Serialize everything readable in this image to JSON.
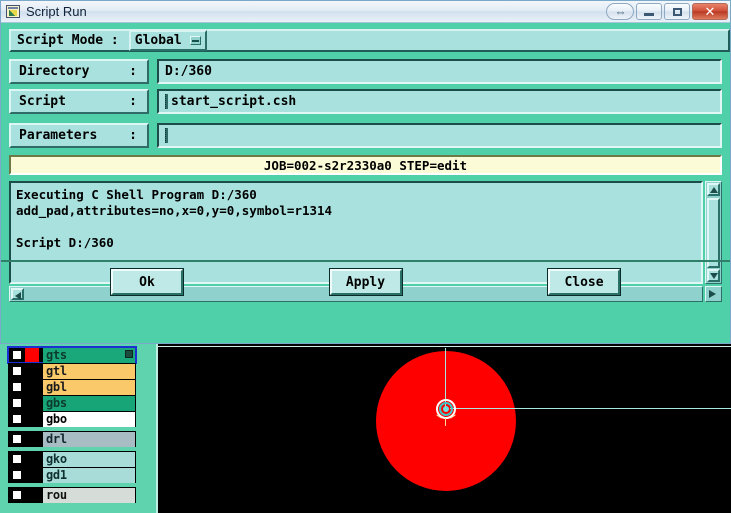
{
  "window": {
    "title": "Script Run",
    "icon": "script-app-icon",
    "controls": {
      "help_label": "⇔",
      "minimize_label": "",
      "maximize_label": "",
      "close_label": "✕"
    }
  },
  "script_mode": {
    "label": "Script Mode  :",
    "value": "Global",
    "dropdown_icon": "chevron-down-icon"
  },
  "fields": [
    {
      "label": "Directory",
      "colon": ":",
      "value": "D:/360",
      "placeholder": "",
      "has_caret": false
    },
    {
      "label": "Script",
      "colon": ":",
      "value": "start_script.csh",
      "placeholder": "",
      "has_caret": true
    },
    {
      "label": "Parameters",
      "colon": ":",
      "value": "",
      "placeholder": "",
      "has_caret": true
    }
  ],
  "status": {
    "text": "JOB=002-s2r2330a0    STEP=edit"
  },
  "console": {
    "lines": [
      "Executing C Shell Program D:/360",
      "add_pad,attributes=no,x=0,y=0,symbol=r1314",
      "",
      "Script D:/360"
    ]
  },
  "buttons": {
    "ok": "Ok",
    "apply": "Apply",
    "close": "Close"
  },
  "layers": {
    "rows": [
      {
        "name": "gts",
        "swatch": "#ff0000",
        "row_color": "#1aa87a",
        "text_color": "#0c3a2c",
        "checked": false,
        "selected": true,
        "badge": true,
        "gap_after": false
      },
      {
        "name": "gtl",
        "swatch": "#000000",
        "row_color": "#fac96a",
        "text_color": "#1b1b1b",
        "checked": false,
        "selected": false,
        "badge": false,
        "gap_after": false
      },
      {
        "name": "gbl",
        "swatch": "#000000",
        "row_color": "#fac96a",
        "text_color": "#1b1b1b",
        "checked": false,
        "selected": false,
        "badge": false,
        "gap_after": false
      },
      {
        "name": "gbs",
        "swatch": "#000000",
        "row_color": "#17a578",
        "text_color": "#0c3a2c",
        "checked": false,
        "selected": false,
        "badge": false,
        "gap_after": false
      },
      {
        "name": "gbo",
        "swatch": "#000000",
        "row_color": "#ffffff",
        "text_color": "#000000",
        "checked": false,
        "selected": false,
        "badge": false,
        "gap_after": true
      },
      {
        "name": "drl",
        "swatch": "#000000",
        "row_color": "#a8bcc4",
        "text_color": "#12262c",
        "checked": false,
        "selected": false,
        "badge": false,
        "gap_after": true
      },
      {
        "name": "gko",
        "swatch": "#000000",
        "row_color": "#a7dcd9",
        "text_color": "#10302e",
        "checked": false,
        "selected": false,
        "badge": false,
        "gap_after": false
      },
      {
        "name": "gd1",
        "swatch": "#000000",
        "row_color": "#a7dcd9",
        "text_color": "#10302e",
        "checked": false,
        "selected": false,
        "badge": false,
        "gap_after": true
      },
      {
        "name": "rou",
        "swatch": "#000000",
        "row_color": "#d6dcd8",
        "text_color": "#121212",
        "checked": false,
        "selected": false,
        "badge": false,
        "gap_after": true
      }
    ]
  },
  "canvas": {
    "pad_color": "#ff0000",
    "background": "#000000",
    "crosshair_color": "#a7e8de",
    "pad_symbol": "r1314"
  },
  "colors": {
    "dialog_bg": "#4fd0a8",
    "field_bg": "#a8e1dd",
    "status_bg": "#fbfbd8",
    "panel_bg": "#5fd3ae"
  }
}
